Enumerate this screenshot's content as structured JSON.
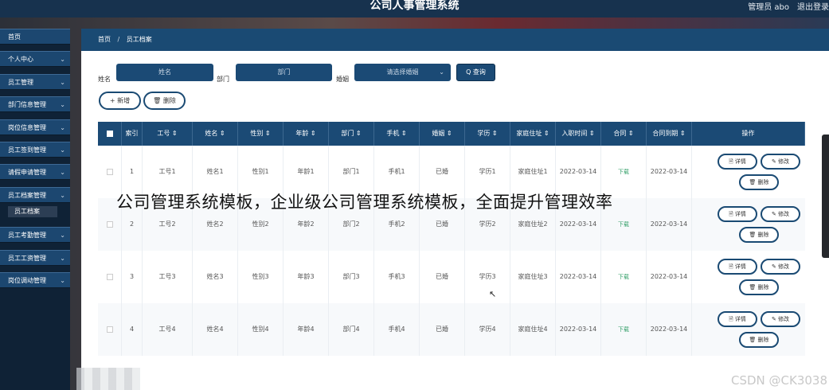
{
  "header": {
    "title": "公司人事管理系统",
    "user": "管理员 abo",
    "logout": "退出登录"
  },
  "sidebar": {
    "items": [
      {
        "label": "首页",
        "chevron": false
      },
      {
        "label": "个人中心",
        "chevron": true
      },
      {
        "label": "员工管理",
        "chevron": true
      },
      {
        "label": "部门信息管理",
        "chevron": true
      },
      {
        "label": "岗位信息管理",
        "chevron": true
      },
      {
        "label": "员工签到管理",
        "chevron": true
      },
      {
        "label": "请假申请管理",
        "chevron": true
      },
      {
        "label": "员工档案管理",
        "chevron": true
      },
      {
        "label": "员工考勤管理",
        "chevron": true
      },
      {
        "label": "员工工资管理",
        "chevron": true
      },
      {
        "label": "岗位调动管理",
        "chevron": true
      }
    ],
    "active_sub": "员工档案"
  },
  "breadcrumb": {
    "home": "首页",
    "sep": "/",
    "current": "员工档案"
  },
  "search": {
    "name_label": "姓名",
    "name_placeholder": "姓名",
    "dept_label": "部门",
    "dept_placeholder": "部门",
    "marriage_label": "婚姻",
    "marriage_placeholder": "请选择婚姻",
    "search_button": "Q 查询"
  },
  "actions": {
    "add": "+ 新增",
    "delete": "🗑 删除"
  },
  "table": {
    "headers": [
      "",
      "索引",
      "工号 ⇕",
      "姓名 ⇕",
      "性别 ⇕",
      "年龄 ⇕",
      "部门 ⇕",
      "手机 ⇕",
      "婚姻 ⇕",
      "学历 ⇕",
      "家庭住址 ⇕",
      "入职时间 ⇕",
      "合同 ⇕",
      "合同到期 ⇕",
      "操作"
    ],
    "rows": [
      [
        "",
        "1",
        "工号1",
        "姓名1",
        "性别1",
        "年龄1",
        "部门1",
        "手机1",
        "已婚",
        "学历1",
        "家庭住址1",
        "2022-03-14",
        "下载",
        "2022-03-14"
      ],
      [
        "",
        "2",
        "工号2",
        "姓名2",
        "性别2",
        "年龄2",
        "部门2",
        "手机2",
        "已婚",
        "学历2",
        "家庭住址2",
        "2022-03-14",
        "下载",
        "2022-03-14"
      ],
      [
        "",
        "3",
        "工号3",
        "姓名3",
        "性别3",
        "年龄3",
        "部门3",
        "手机3",
        "已婚",
        "学历3",
        "家庭住址3",
        "2022-03-14",
        "下载",
        "2022-03-14"
      ],
      [
        "",
        "4",
        "工号4",
        "姓名4",
        "性别4",
        "年龄4",
        "部门4",
        "手机4",
        "已婚",
        "学历4",
        "家庭住址4",
        "2022-03-14",
        "下载",
        "2022-03-14"
      ]
    ],
    "op_labels": {
      "detail": "🗎 详情",
      "edit": "✎ 修改",
      "delete": "🗑 删除"
    }
  },
  "overlay": {
    "caption": "公司管理系统模板，企业级公司管理系统模板，全面提升管理效率",
    "watermark": "CSDN @CK3038"
  }
}
